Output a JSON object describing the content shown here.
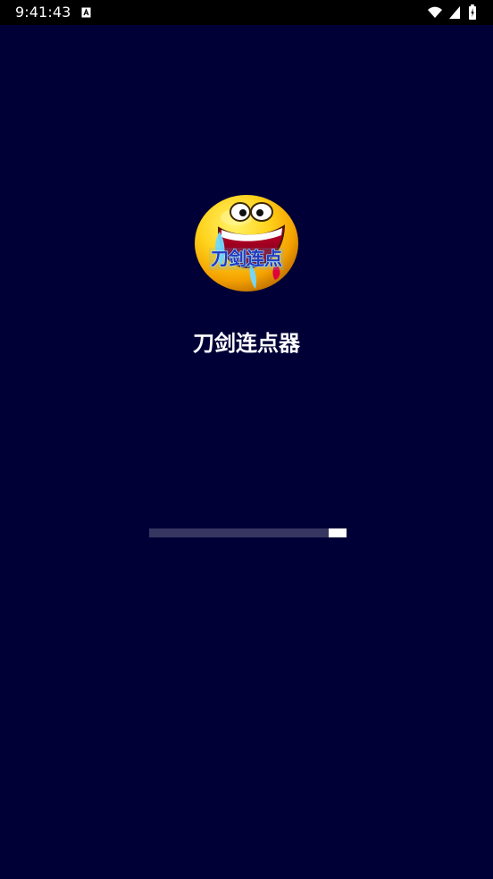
{
  "status_bar": {
    "time": "9:41:43",
    "icons": [
      "a-icon",
      "wifi-icon",
      "signal-icon",
      "battery-icon"
    ]
  },
  "app": {
    "title": "刀剑连点器",
    "logo_text": "刀剑连点",
    "background_color": "#000037",
    "loading_progress": 0.91
  }
}
